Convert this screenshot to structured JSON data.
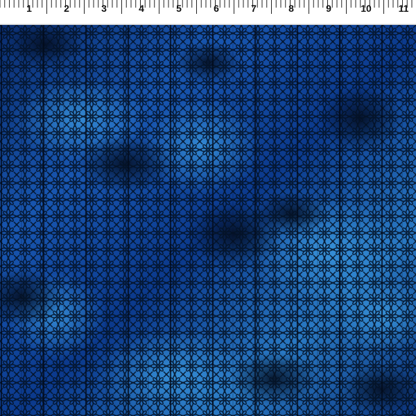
{
  "ruler": {
    "unit_labels": [
      "1",
      "2",
      "3",
      "4",
      "5",
      "6",
      "7",
      "8",
      "9",
      "10",
      "11"
    ]
  },
  "fabric": {
    "pattern_motif": "lace-flower",
    "colors": {
      "base_deep_blue": "#0b3f94",
      "highlight_blue": "#2f8fd8",
      "shadow_blue": "#061a46",
      "line_black": "#03101f"
    }
  }
}
